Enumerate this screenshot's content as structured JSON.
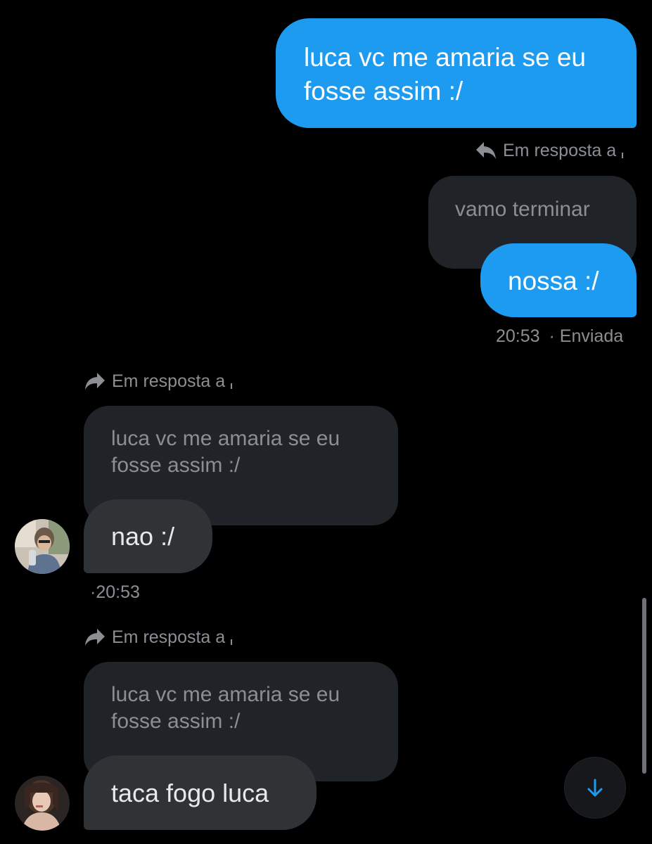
{
  "messages": {
    "sent1": {
      "text_line1": "luca vc me amaria se eu",
      "text_line2": "fosse assim :/"
    },
    "reply1": {
      "label": "Em resposta a"
    },
    "quote1": {
      "text": "vamo terminar"
    },
    "sent2": {
      "text": "nossa :/",
      "time": "20:53",
      "status": "· Enviada"
    },
    "reply2": {
      "label": "Em resposta a"
    },
    "quote2": {
      "text_line1": "luca vc me amaria se eu",
      "text_line2": "fosse assim :/"
    },
    "recv1": {
      "text": "nao :/",
      "time": "·20:53"
    },
    "reply3": {
      "label": "Em resposta a"
    },
    "quote3": {
      "text_line1": "luca vc me amaria se eu",
      "text_line2": "fosse assim :/"
    },
    "recv2": {
      "text": "taca fogo luca"
    }
  },
  "icons": {
    "reply_sent": "reply-icon",
    "reply_received": "forward-reply-icon",
    "scroll_down": "arrow-down-icon"
  },
  "colors": {
    "background": "#000000",
    "sent_bubble": "#1d9bf0",
    "received_bubble": "#2f3336",
    "quote_bubble": "#202327",
    "muted_text": "#8b8f94",
    "accent": "#1d9bf0"
  }
}
